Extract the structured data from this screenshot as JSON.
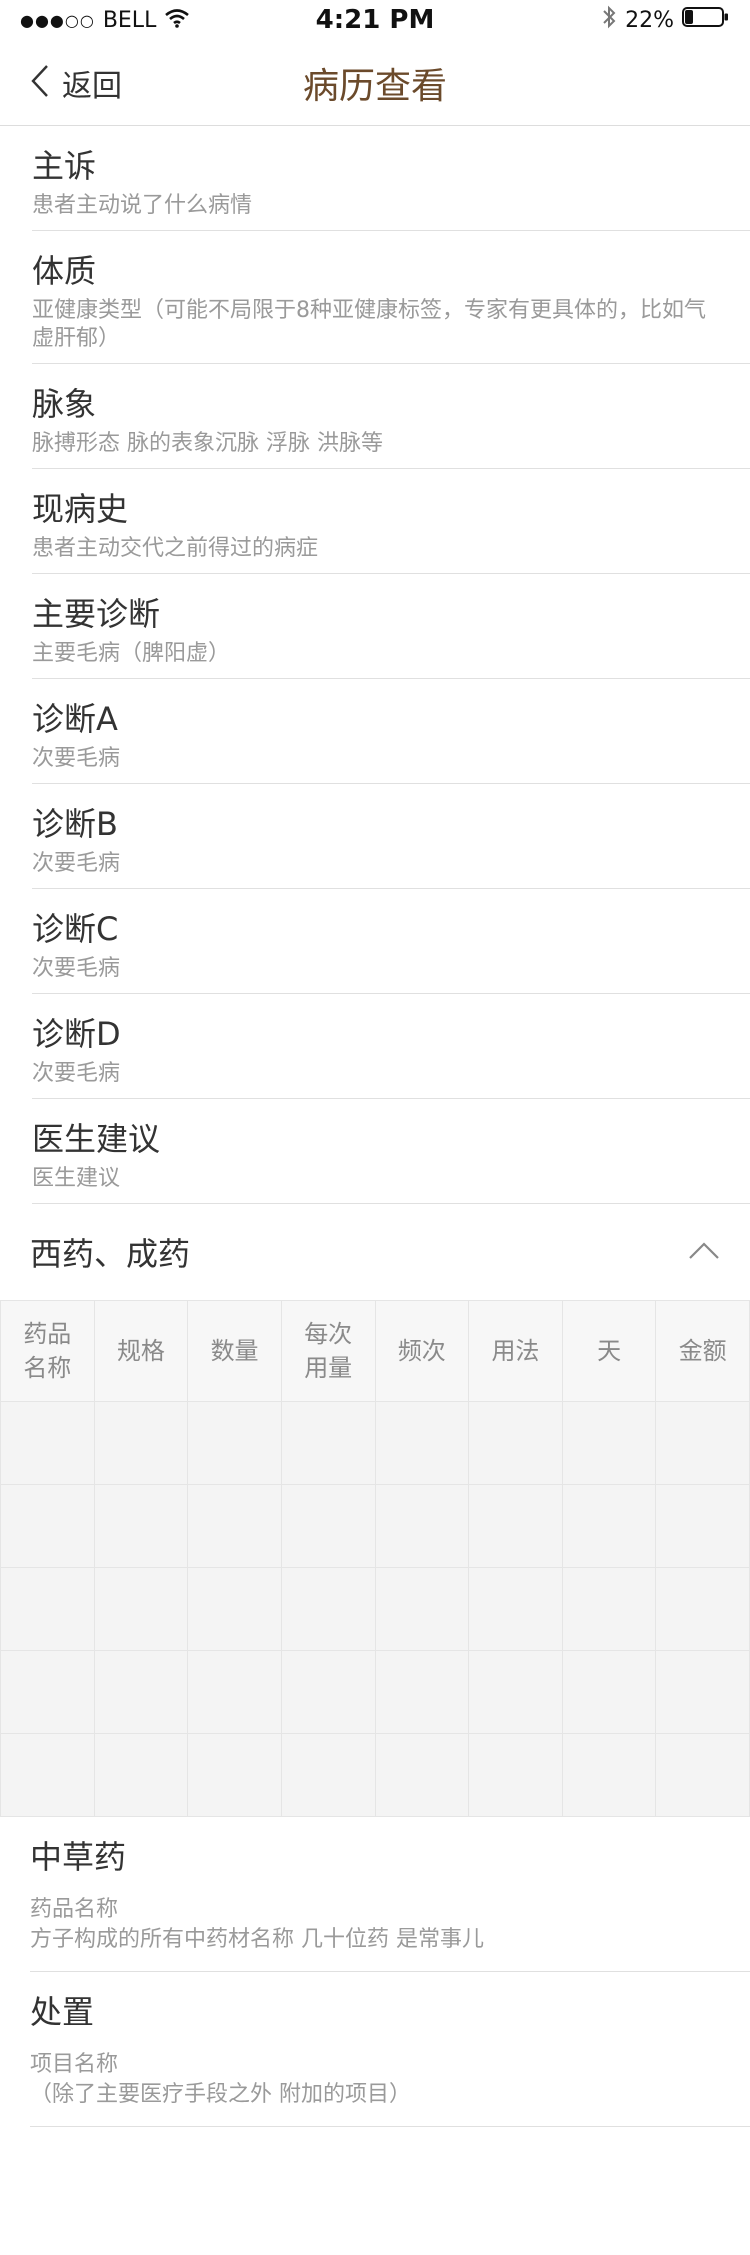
{
  "status_bar": {
    "carrier": "BELL",
    "time": "4:21 PM",
    "battery": "22%",
    "battery_level": 0.22
  },
  "header": {
    "back_label": "返回",
    "title": "病历查看"
  },
  "sections": [
    {
      "title": "主诉",
      "sub": "患者主动说了什么病情"
    },
    {
      "title": "体质",
      "sub": "亚健康类型（可能不局限于8种亚健康标签，专家有更具体的，比如气虚肝郁）"
    },
    {
      "title": "脉象",
      "sub": "脉搏形态 脉的表象沉脉 浮脉 洪脉等"
    },
    {
      "title": "现病史",
      "sub": "患者主动交代之前得过的病症"
    },
    {
      "title": "主要诊断",
      "sub": "主要毛病（脾阳虚）"
    },
    {
      "title": "诊断A",
      "sub": "次要毛病"
    },
    {
      "title": "诊断B",
      "sub": "次要毛病"
    },
    {
      "title": "诊断C",
      "sub": "次要毛病"
    },
    {
      "title": "诊断D",
      "sub": "次要毛病"
    },
    {
      "title": "医生建议",
      "sub": "医生建议"
    }
  ],
  "western_medicine": {
    "title": "西药、成药",
    "columns": [
      [
        "药品",
        "名称"
      ],
      [
        "规格"
      ],
      [
        "数量"
      ],
      [
        "每次",
        "用量"
      ],
      [
        "频次"
      ],
      [
        "用法"
      ],
      [
        "天"
      ],
      [
        "金额"
      ]
    ]
  },
  "herbal": {
    "title": "中草药",
    "line1": "药品名称",
    "line2": "方子构成的所有中药材名称 几十位药 是常事儿"
  },
  "disposal": {
    "title": "处置",
    "line1": "项目名称",
    "line2": "（除了主要医疗手段之外 附加的项目）"
  },
  "colors": {
    "title_brown": "#6b4a2b",
    "divider": "#e0e0e0",
    "sub_text": "#9a9a9a"
  }
}
